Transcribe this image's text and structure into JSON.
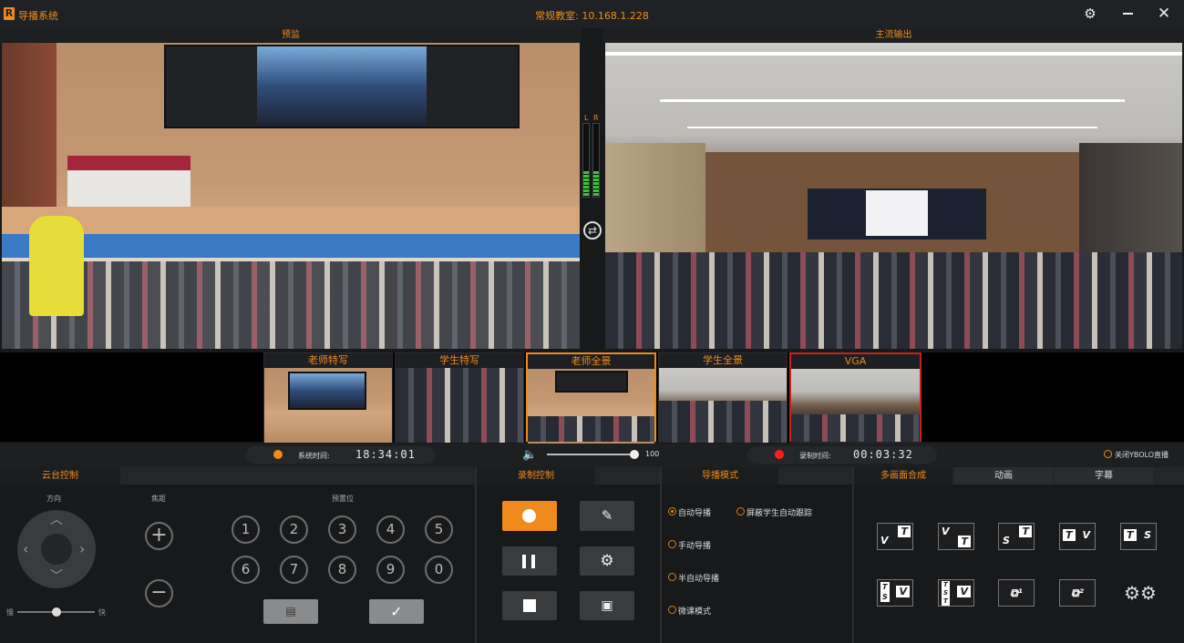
{
  "app": {
    "logo": "R",
    "title": "导播系统",
    "classroom": "常规教室: 10.168.1.228"
  },
  "window": {
    "settings_icon": "gear-icon",
    "minimize_icon": "minimize-icon",
    "close_icon": "close-icon"
  },
  "panels": {
    "preview": "预监",
    "output": "主流输出"
  },
  "audio": {
    "left": "L",
    "right": "R",
    "level_left": 0.35,
    "level_right": 0.35
  },
  "thumbs": [
    {
      "label": "老师特写",
      "active": false
    },
    {
      "label": "学生特写",
      "active": false
    },
    {
      "label": "老师全景",
      "active": true
    },
    {
      "label": "学生全景",
      "active": false
    },
    {
      "label": "VGA",
      "active": false,
      "live": true
    }
  ],
  "status": {
    "system_time_label": "系统时间:",
    "system_time": "18:34:01",
    "volume": "100",
    "volume_level": 1.0,
    "record_time_label": "录制时间:",
    "record_time": "00:03:32",
    "ybolo": "关闭YBOLO直播"
  },
  "ptz": {
    "tab": "云台控制",
    "direction": "方向",
    "focus": "焦距",
    "preset": "预置位",
    "slow": "慢",
    "fast": "快",
    "speed_level": 0.5,
    "presets": [
      "1",
      "2",
      "3",
      "4",
      "5",
      "6",
      "7",
      "8",
      "9",
      "0"
    ]
  },
  "record": {
    "tab": "录制控制"
  },
  "director": {
    "tab": "导播模式",
    "modes": [
      "自动导播",
      "手动导播",
      "半自动导播",
      "微课模式"
    ],
    "selected": "自动导播",
    "block_tracking": "屏蔽学生自动跟踪"
  },
  "compose": {
    "tabs": [
      "多画面合成",
      "动画",
      "字幕"
    ],
    "active_tab": "多画面合成"
  },
  "colors": {
    "accent": "#f08a1c",
    "record_red": "#ff1e1e",
    "live_border": "#c4241c"
  }
}
